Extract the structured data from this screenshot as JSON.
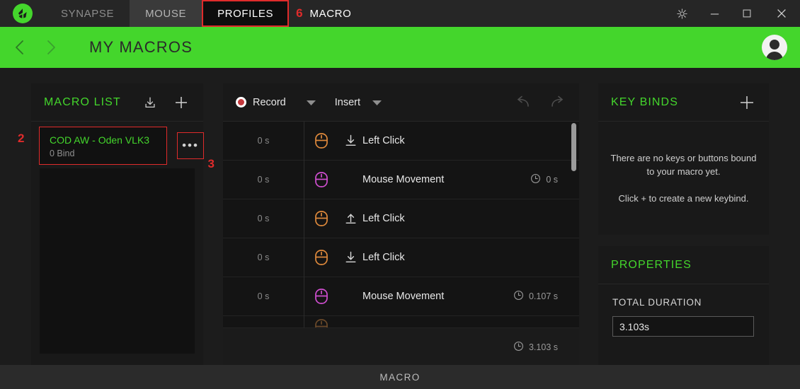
{
  "titlebar": {
    "logo_icon": "razer-logo-icon",
    "tabs": [
      {
        "label": "SYNAPSE",
        "state": "normal"
      },
      {
        "label": "MOUSE",
        "state": "hover"
      },
      {
        "label": "PROFILES",
        "state": "active-annotated"
      },
      {
        "label": "MACRO",
        "state": "plain"
      }
    ],
    "annotations": {
      "macro_tab_number": "6"
    },
    "window_controls": [
      {
        "name": "settings-gear-icon",
        "glyph": "gear"
      },
      {
        "name": "minimize-icon",
        "glyph": "minimize"
      },
      {
        "name": "maximize-icon",
        "glyph": "maximize"
      },
      {
        "name": "close-icon",
        "glyph": "close"
      }
    ]
  },
  "header": {
    "back_icon": "chevron-left-icon",
    "forward_icon": "chevron-right-icon",
    "title": "MY MACROS",
    "avatar_icon": "user-avatar-icon",
    "accent_color": "#44d62c"
  },
  "macro_list": {
    "title": "MACRO LIST",
    "import_icon": "import-download-icon",
    "add_icon": "plus-icon",
    "items": [
      {
        "name": "COD AW - Oden VLK3",
        "bind": "0 Bind",
        "selected": true
      }
    ],
    "more_button_label": "•••",
    "annotations": {
      "item_number": "2",
      "more_button_number": "3"
    }
  },
  "editor": {
    "record_label": "Record",
    "record_icon": "record-circle-icon",
    "record_caret_icon": "chevron-down-icon",
    "insert_label": "Insert",
    "insert_caret_icon": "chevron-down-icon",
    "undo_icon": "undo-arrow-icon",
    "redo_icon": "redo-arrow-icon",
    "columns": {
      "delay": "",
      "device": "",
      "action": "",
      "duration": ""
    },
    "events": [
      {
        "delay": "0 s",
        "device_icon": "mouse-icon",
        "device_color": "#e08a3c",
        "direction_icon": "arrow-down-icon",
        "label": "Left Click",
        "duration": ""
      },
      {
        "delay": "0 s",
        "device_icon": "mouse-icon",
        "device_color": "#d14fd1",
        "direction_icon": "",
        "label": "Mouse Movement",
        "duration": "0 s"
      },
      {
        "delay": "0 s",
        "device_icon": "mouse-icon",
        "device_color": "#e08a3c",
        "direction_icon": "arrow-up-icon",
        "label": "Left Click",
        "duration": ""
      },
      {
        "delay": "0 s",
        "device_icon": "mouse-icon",
        "device_color": "#e08a3c",
        "direction_icon": "arrow-down-icon",
        "label": "Left Click",
        "duration": ""
      },
      {
        "delay": "0 s",
        "device_icon": "mouse-icon",
        "device_color": "#d14fd1",
        "direction_icon": "",
        "label": "Mouse Movement",
        "duration": "0.107 s"
      }
    ],
    "total_duration": "3.103 s",
    "total_duration_icon": "clock-icon"
  },
  "keybinds": {
    "title": "KEY BINDS",
    "add_icon": "plus-icon",
    "empty_message": "There are no keys or buttons bound to your macro yet.",
    "empty_hint": "Click + to create a new keybind."
  },
  "properties": {
    "title": "PROPERTIES",
    "duration_label": "TOTAL DURATION",
    "duration_value": "3.103s"
  },
  "statusbar": {
    "text": "MACRO"
  }
}
